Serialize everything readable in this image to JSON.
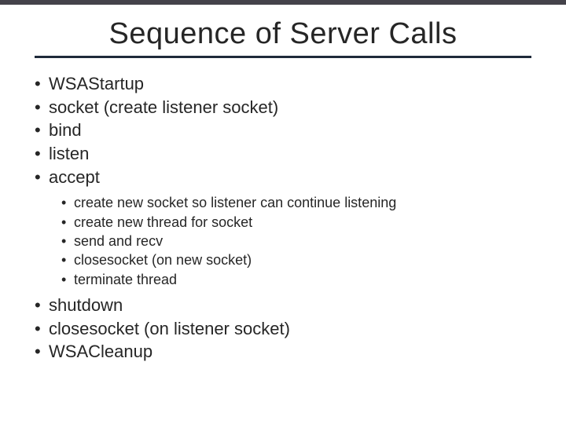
{
  "title": "Sequence of Server Calls",
  "items": {
    "i0": "WSAStartup",
    "i1": "socket (create listener socket)",
    "i2": "bind",
    "i3": "listen",
    "i4": "accept",
    "i5": "shutdown",
    "i6": "closesocket (on listener socket)",
    "i7": "WSACleanup"
  },
  "sub": {
    "s0": "create new socket so listener can continue listening",
    "s1": "create new thread for socket",
    "s2": "send and recv",
    "s3": "closesocket (on new socket)",
    "s4": "terminate thread"
  }
}
